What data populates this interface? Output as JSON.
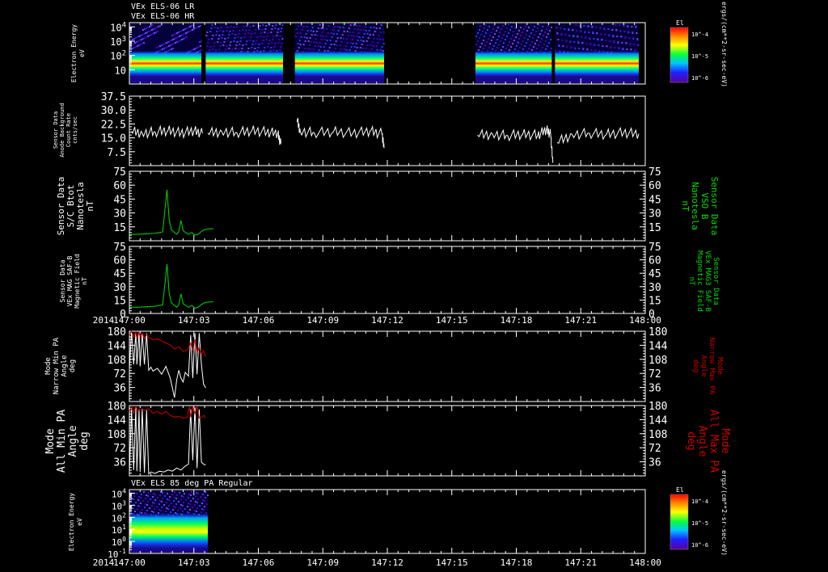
{
  "chart_data": [
    {
      "type": "heatmap",
      "titles": [
        "VEx ELS-06 LR",
        "VEx ELS-06 HR"
      ],
      "ylabel": [
        "Electron Energy",
        "eV"
      ],
      "ytick_labels": [
        "10^4",
        "10^3",
        "10^2",
        "10"
      ],
      "yscale": "log",
      "ylim": [
        1,
        20000
      ],
      "colorbar": {
        "label": "El",
        "ticks": [
          "10^-4",
          "10^-5",
          "10^-6"
        ]
      },
      "colorbar_units": "ergs/(cm**2-sr-sec-eV)",
      "data_segments_minutes": [
        [
          0,
          3.35
        ],
        [
          3.55,
          7.15
        ],
        [
          7.7,
          11.85
        ],
        [
          16.1,
          19.65
        ],
        [
          19.8,
          23.7
        ]
      ],
      "background_band_ev": [
        10,
        100
      ]
    },
    {
      "type": "line",
      "ylabel": [
        "Sensor Data",
        "Anode Background",
        "Count Rate",
        "cnts/sec"
      ],
      "ytick_labels": [
        "37.5",
        "30.0",
        "22.5",
        "15.0",
        "7.5"
      ],
      "ylim": [
        0,
        37.5
      ],
      "series": [
        {
          "color": "#ffffff",
          "segments": [
            {
              "x": [
                0.1,
                0.6,
                1.2,
                1.8,
                2.4,
                3.0,
                3.4
              ],
              "y": [
                18.5,
                17.5,
                18.2,
                19,
                17.6,
                18.8,
                17.4
              ]
            },
            {
              "x": [
                3.65,
                4.3,
                5.0,
                5.7,
                6.4,
                6.9,
                7.05
              ],
              "y": [
                17.6,
                18.3,
                17.8,
                18.9,
                18.1,
                17.5,
                11.6
              ]
            },
            {
              "x": [
                7.8,
                7.95,
                8.6,
                9.5,
                10.4,
                11.2,
                11.75,
                11.85
              ],
              "y": [
                25,
                18.4,
                17.8,
                18.3,
                17.6,
                18.6,
                17.2,
                9.5
              ]
            },
            {
              "x": [
                16.2,
                16.9,
                17.6,
                18.3,
                19.0,
                19.4,
                19.6,
                19.7
              ],
              "y": [
                16.5,
                16.9,
                16.2,
                17.0,
                16.4,
                19.5,
                16.8,
                1.5
              ]
            },
            {
              "x": [
                19.9,
                20.6,
                21.4,
                22.2,
                23.0,
                23.7
              ],
              "y": [
                12.5,
                16.8,
                17.5,
                16.9,
                17.8,
                17.2
              ]
            }
          ]
        }
      ]
    },
    {
      "type": "line",
      "ylabel": [
        "Sensor Data",
        "S/C Btot",
        "Nanotesla",
        "nT"
      ],
      "ylabel_right": [
        "Sensor Data",
        "VSO B",
        "Nanotesla",
        "nT"
      ],
      "ytick_labels": [
        "75",
        "60",
        "45",
        "30",
        "15"
      ],
      "ylim": [
        0,
        75
      ],
      "series": [
        {
          "color": "#00dd00",
          "x": [
            0,
            0.4,
            0.8,
            1.2,
            1.4,
            1.55,
            1.65,
            1.75,
            1.85,
            1.95,
            2.1,
            2.2,
            2.3,
            2.4,
            2.5,
            2.6,
            2.75,
            2.9,
            3.05,
            3.2,
            3.35,
            3.5,
            3.6,
            3.75,
            3.9
          ],
          "y": [
            7,
            7,
            7.5,
            8,
            9,
            9.5,
            33,
            55,
            23,
            12,
            9,
            7,
            10,
            22,
            11,
            9,
            7,
            9,
            6,
            7,
            10,
            12,
            12.5,
            13,
            13
          ]
        }
      ]
    },
    {
      "type": "line",
      "ylabel": [
        "Sensor Data",
        "VEx MAG SAF-B",
        "Magnetic Field",
        "nT"
      ],
      "ylabel_right": [
        "Sensor Data",
        "VEx MAG3 SAF-B",
        "Magnetic Field",
        "nT"
      ],
      "ytick_labels": [
        "75",
        "60",
        "45",
        "30",
        "15",
        "0"
      ],
      "ylim": [
        0,
        75
      ],
      "x_year_label": "2014",
      "xtick_labels": [
        "147:00",
        "147:03",
        "147:06",
        "147:09",
        "147:12",
        "147:15",
        "147:18",
        "147:21",
        "148:00"
      ],
      "series": [
        {
          "color": "#00dd00",
          "x": [
            0,
            0.4,
            0.8,
            1.2,
            1.4,
            1.55,
            1.65,
            1.75,
            1.85,
            1.95,
            2.1,
            2.2,
            2.3,
            2.4,
            2.5,
            2.6,
            2.75,
            2.9,
            3.05,
            3.2,
            3.35,
            3.5,
            3.6,
            3.75,
            3.9
          ],
          "y": [
            7,
            7,
            7.5,
            8,
            9,
            9.5,
            33,
            55,
            23,
            12,
            9,
            7,
            10,
            22,
            11,
            9,
            7,
            9,
            6,
            7,
            10,
            12,
            12.5,
            13,
            13
          ]
        }
      ]
    },
    {
      "type": "line",
      "ylabel": [
        "Mode",
        "Narrow Min PA",
        "Angle",
        "deg"
      ],
      "ylabel_right": [
        "Mode",
        "Narrow Max PA",
        "Angle",
        "deg"
      ],
      "ytick_labels": [
        "180",
        "144",
        "108",
        "72",
        "36"
      ],
      "ylim": [
        0,
        180
      ],
      "series": [
        {
          "name": "Narrow Min PA",
          "color": "#ffffff",
          "x": [
            0,
            0.1,
            0.2,
            0.3,
            0.35,
            0.45,
            0.5,
            0.6,
            0.7,
            0.8,
            0.9,
            1.0,
            1.1,
            1.3,
            1.5,
            1.7,
            1.9,
            2.0,
            2.1,
            2.2,
            2.3,
            2.4,
            2.5,
            2.6,
            2.75,
            2.85,
            2.95,
            3.05,
            3.15,
            3.25,
            3.35,
            3.45,
            3.55
          ],
          "y": [
            85,
            180,
            95,
            175,
            95,
            178,
            90,
            175,
            95,
            175,
            80,
            88,
            78,
            85,
            70,
            90,
            60,
            35,
            10,
            55,
            80,
            60,
            50,
            75,
            65,
            170,
            60,
            175,
            70,
            175,
            95,
            45,
            35
          ]
        },
        {
          "name": "Narrow Max PA",
          "color": "#cc0000",
          "x": [
            0,
            0.1,
            0.2,
            0.3,
            0.35,
            0.45,
            0.5,
            0.6,
            0.7,
            0.8,
            0.9,
            1.0,
            1.1,
            1.3,
            1.5,
            1.7,
            1.9,
            2.1,
            2.3,
            2.5,
            2.7,
            2.85,
            2.95,
            3.05,
            3.15,
            3.25,
            3.35,
            3.45,
            3.55
          ],
          "y": [
            170,
            180,
            165,
            178,
            160,
            178,
            165,
            175,
            160,
            172,
            165,
            162,
            158,
            160,
            155,
            150,
            145,
            135,
            140,
            128,
            132,
            150,
            130,
            160,
            125,
            140,
            120,
            130,
            115
          ]
        }
      ]
    },
    {
      "type": "line",
      "ylabel": [
        "Mode",
        "All Min PA",
        "Angle",
        "deg"
      ],
      "ylabel_right": [
        "Mode",
        "All Max PA",
        "Angle",
        "deg"
      ],
      "ytick_labels": [
        "180",
        "144",
        "108",
        "72",
        "36"
      ],
      "ylim": [
        0,
        180
      ],
      "series": [
        {
          "name": "All Min PA",
          "color": "#ffffff",
          "x": [
            0,
            0.1,
            0.2,
            0.3,
            0.35,
            0.45,
            0.5,
            0.6,
            0.7,
            0.8,
            0.9,
            1.0,
            1.2,
            1.4,
            1.6,
            1.8,
            2.0,
            2.2,
            2.4,
            2.6,
            2.75,
            2.85,
            2.95,
            3.05,
            3.15,
            3.25,
            3.35,
            3.45,
            3.55
          ],
          "y": [
            10,
            170,
            15,
            175,
            12,
            170,
            10,
            172,
            8,
            168,
            5,
            10,
            6,
            12,
            10,
            15,
            12,
            20,
            15,
            25,
            30,
            170,
            40,
            175,
            20,
            170,
            35,
            30,
            28
          ]
        },
        {
          "name": "All Max PA",
          "color": "#cc0000",
          "x": [
            0,
            0.1,
            0.2,
            0.3,
            0.4,
            0.5,
            0.7,
            0.9,
            1.1,
            1.3,
            1.5,
            1.7,
            1.9,
            2.1,
            2.3,
            2.5,
            2.7,
            2.8,
            2.85,
            2.95,
            3.05,
            3.15,
            3.25,
            3.35,
            3.45,
            3.55
          ],
          "y": [
            165,
            178,
            160,
            178,
            165,
            170,
            168,
            172,
            160,
            165,
            158,
            165,
            155,
            150,
            152,
            148,
            150,
            178,
            150,
            178,
            160,
            178,
            148,
            150,
            155,
            148
          ]
        }
      ]
    },
    {
      "type": "heatmap",
      "title": "VEx ELS 85 deg PA Regular",
      "ylabel": [
        "Electron Energy",
        "eV"
      ],
      "ytick_labels": [
        "10^4",
        "10^3",
        "10^2",
        "10^1",
        "10^0",
        "10^-1"
      ],
      "yscale": "log",
      "ylim": [
        0.1,
        20000
      ],
      "x_year_label": "2014",
      "xtick_labels": [
        "147:00",
        "147:03",
        "147:06",
        "147:09",
        "147:12",
        "147:15",
        "147:18",
        "147:21",
        "148:00"
      ],
      "colorbar": {
        "label": "El",
        "ticks": [
          "10^-4",
          "10^-5",
          "10^-6"
        ]
      },
      "colorbar_units": "ergs/(cm**2-sr-sec-eV)",
      "data_segments_minutes": [
        [
          0,
          3.65
        ]
      ],
      "background_band_ev": [
        1,
        100
      ]
    }
  ]
}
